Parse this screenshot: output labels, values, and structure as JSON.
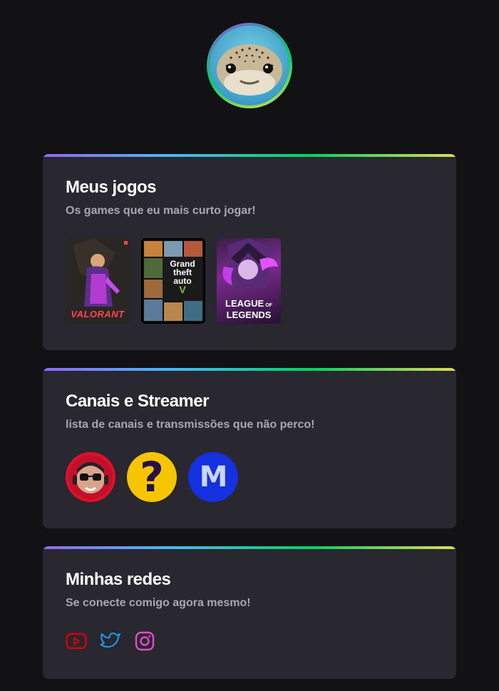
{
  "profile": {
    "avatar": "pufferfish-avatar"
  },
  "sections": {
    "games": {
      "title": "Meus jogos",
      "subtitle": "Os games que eu mais curto jogar!",
      "items": [
        {
          "name": "valorant",
          "label": "VALORANT"
        },
        {
          "name": "gta-v",
          "label_line1": "Grand",
          "label_line2": "theft",
          "label_line3": "auto",
          "label_mark": "V"
        },
        {
          "name": "league-of-legends",
          "label_line1": "LEAGUE",
          "label_of": "OF",
          "label_line2": "LEGENDS"
        }
      ]
    },
    "channels": {
      "title": "Canais e Streamer",
      "subtitle": "lista de canais e transmissões que não perco!",
      "items": [
        {
          "name": "channel-streamer-glasses"
        },
        {
          "name": "channel-question-mark",
          "glyph": "?"
        },
        {
          "name": "channel-m",
          "glyph": "M"
        }
      ]
    },
    "socials": {
      "title": "Minhas redes",
      "subtitle": "Se conecte comigo agora mesmo!",
      "items": [
        {
          "name": "youtube-icon",
          "color": "#d8000c"
        },
        {
          "name": "twitter-icon",
          "color": "#1d9bf0"
        },
        {
          "name": "instagram-icon",
          "color": "#e44ccb"
        }
      ]
    }
  }
}
